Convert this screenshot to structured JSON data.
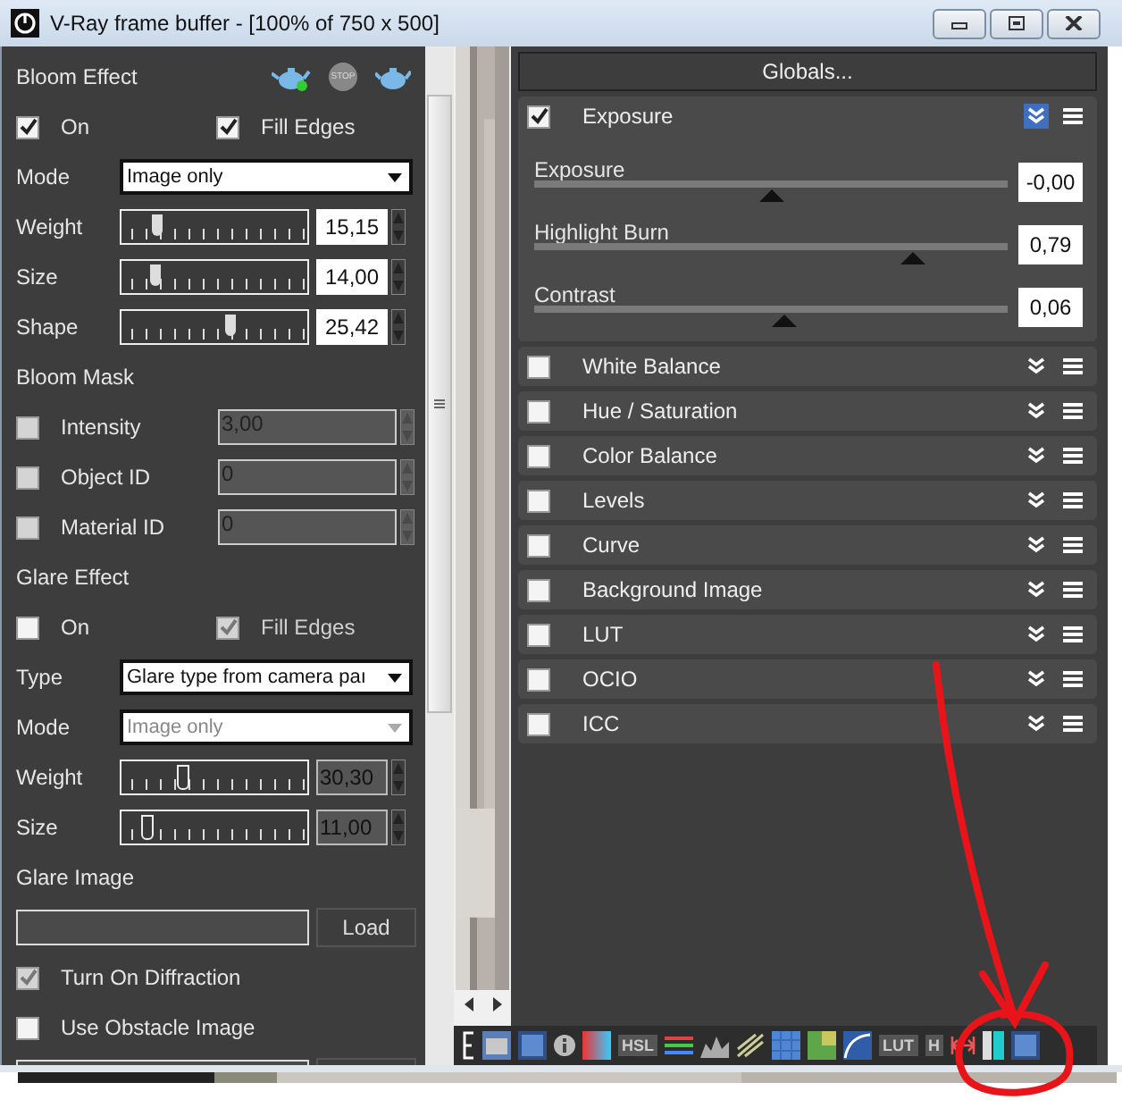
{
  "window": {
    "title": "V-Ray frame buffer - [100% of 750 x 500]"
  },
  "left_panel": {
    "rows": [
      {
        "kind": "header",
        "label": "Bloom Effect",
        "tools": [
          {
            "kind": "render"
          },
          {
            "kind": "stop",
            "label": "STOP"
          },
          {
            "kind": "teapot"
          }
        ]
      },
      {
        "kind": "check_pair",
        "items": [
          {
            "label": "On",
            "checked": true,
            "disabled": false
          },
          {
            "label": "Fill Edges",
            "checked": true,
            "disabled": false
          }
        ]
      },
      {
        "kind": "dropdown",
        "label": "Mode",
        "value": "Image only",
        "disabled": false
      },
      {
        "kind": "slider",
        "label": "Weight",
        "level": 0.17,
        "value": "15,15",
        "disabled": false
      },
      {
        "kind": "slider",
        "label": "Size",
        "level": 0.15,
        "value": "14,00",
        "disabled": false
      },
      {
        "kind": "slider",
        "label": "Shape",
        "level": 0.62,
        "value": "25,42",
        "disabled": false
      },
      {
        "kind": "header",
        "label": "Bloom Mask"
      },
      {
        "kind": "check_field",
        "label": "Intensity",
        "checked": false,
        "value": "3,00"
      },
      {
        "kind": "check_field",
        "label": "Object ID",
        "checked": false,
        "value": "0"
      },
      {
        "kind": "check_field",
        "label": "Material ID",
        "checked": false,
        "value": "0"
      },
      {
        "kind": "header",
        "label": "Glare Effect"
      },
      {
        "kind": "check_pair",
        "items": [
          {
            "label": "On",
            "checked": false,
            "disabled": false
          },
          {
            "label": "Fill Edges",
            "checked": true,
            "disabled": true
          }
        ]
      },
      {
        "kind": "dropdown",
        "label": "Type",
        "value": "Glare type from camera paı",
        "disabled": false
      },
      {
        "kind": "dropdown",
        "label": "Mode",
        "value": "Image only",
        "disabled": true
      },
      {
        "kind": "slider",
        "label": "Weight",
        "level": 0.32,
        "value": "30,30",
        "disabled": true
      },
      {
        "kind": "slider",
        "label": "Size",
        "level": 0.1,
        "value": "11,00",
        "disabled": true
      },
      {
        "kind": "header",
        "label": "Glare Image"
      },
      {
        "kind": "file",
        "button": "Load"
      },
      {
        "kind": "check",
        "label": "Turn On Diffraction",
        "checked": true,
        "disabled": true
      },
      {
        "kind": "check",
        "label": "Use Obstacle Image",
        "checked": false,
        "disabled": false
      },
      {
        "kind": "file"
      }
    ]
  },
  "right_panel": {
    "globals_button": "Globals...",
    "layers": [
      {
        "label": "Exposure",
        "enabled": true,
        "expanded": true,
        "sliders": [
          {
            "label": "Exposure",
            "level": 0.5,
            "value": "-0,00"
          },
          {
            "label": "Highlight Burn",
            "level": 0.8,
            "value": "0,79"
          },
          {
            "label": "Contrast",
            "level": 0.53,
            "value": "0,06"
          }
        ]
      },
      {
        "label": "White Balance",
        "enabled": false,
        "expanded": false
      },
      {
        "label": "Hue / Saturation",
        "enabled": false,
        "expanded": false
      },
      {
        "label": "Color Balance",
        "enabled": false,
        "expanded": false
      },
      {
        "label": "Levels",
        "enabled": false,
        "expanded": false
      },
      {
        "label": "Curve",
        "enabled": false,
        "expanded": false
      },
      {
        "label": "Background Image",
        "enabled": false,
        "expanded": false
      },
      {
        "label": "LUT",
        "enabled": false,
        "expanded": false
      },
      {
        "label": "OCIO",
        "enabled": false,
        "expanded": false
      },
      {
        "label": "ICC",
        "enabled": false,
        "expanded": false
      }
    ]
  },
  "toolbar": [
    {
      "kind": "bracket"
    },
    {
      "kind": "gray_swatch"
    },
    {
      "kind": "blue_swatch"
    },
    {
      "kind": "info"
    },
    {
      "kind": "gradient"
    },
    {
      "kind": "text",
      "label": "HSL"
    },
    {
      "kind": "bars"
    },
    {
      "kind": "histogram"
    },
    {
      "kind": "lines"
    },
    {
      "kind": "grid"
    },
    {
      "kind": "green_swatch"
    },
    {
      "kind": "curve"
    },
    {
      "kind": "text",
      "label": "LUT"
    },
    {
      "kind": "text",
      "label": "H"
    },
    {
      "kind": "width"
    },
    {
      "kind": "cyan_bars"
    },
    {
      "kind": "blue_swatch"
    }
  ],
  "annotation": {
    "kind": "arrow_and_circle"
  }
}
